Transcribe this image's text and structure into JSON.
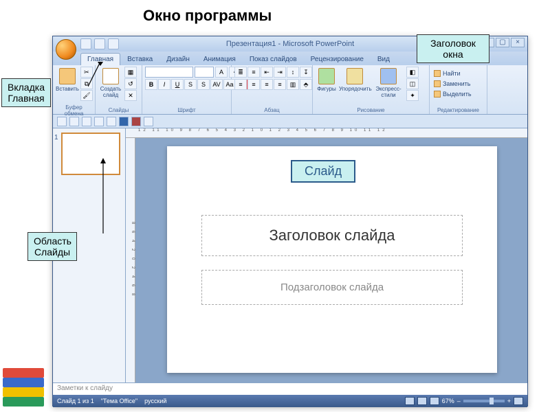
{
  "page_title": "Окно программы",
  "callouts": {
    "title_bar": "Заголовок окна",
    "home_tab": "Вкладка Главная",
    "slides_pane": "Область Слайды",
    "slide": "Слайд"
  },
  "titlebar": {
    "title": "Презентация1 - Microsoft PowerPoint"
  },
  "tabs": {
    "home": "Главная",
    "insert": "Вставка",
    "design": "Дизайн",
    "animation": "Анимация",
    "slideshow": "Показ слайдов",
    "review": "Рецензирование",
    "view": "Вид"
  },
  "ribbon": {
    "clipboard": {
      "paste": "Вставить",
      "label": "Буфер обмена"
    },
    "slides": {
      "new_slide": "Создать слайд",
      "label": "Слайды"
    },
    "font": {
      "label": "Шрифт"
    },
    "paragraph": {
      "label": "Абзац"
    },
    "drawing": {
      "shapes": "Фигуры",
      "arrange": "Упорядочить",
      "styles": "Экспресс-стили",
      "label": "Рисование"
    },
    "editing": {
      "find": "Найти",
      "replace": "Заменить",
      "select": "Выделить",
      "label": "Редактирование"
    }
  },
  "ruler_h": "12 11 10 9 8 7 6 5 4 3 2 1 0 1 2 3 4 5 6 7 8 9 10 11 12",
  "ruler_v": "8 6 4 2 0 2 4 6 8",
  "slide": {
    "title_placeholder": "Заголовок слайда",
    "subtitle_placeholder": "Подзаголовок слайда"
  },
  "thumbnail": {
    "number": "1"
  },
  "notes": {
    "placeholder": "Заметки к слайду"
  },
  "status": {
    "slide_count": "Слайд 1 из 1",
    "theme": "\"Тема Office\"",
    "lang": "русский",
    "zoom": "67%"
  }
}
